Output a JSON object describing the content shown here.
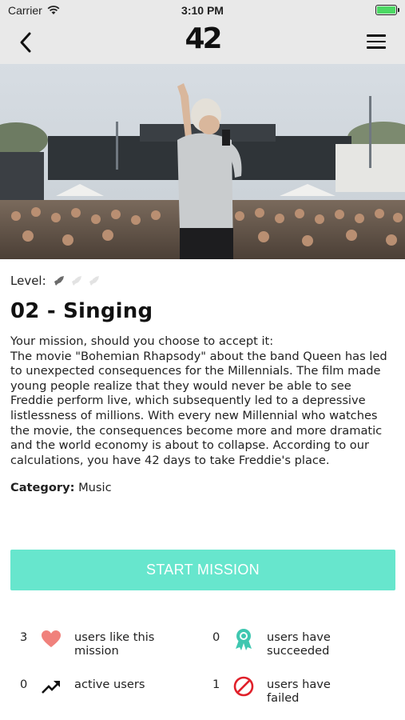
{
  "status_bar": {
    "carrier": "Carrier",
    "time": "3:10 PM",
    "battery_level": 1.0
  },
  "nav": {
    "logo": "42",
    "back_icon": "chevron-left-icon",
    "menu_icon": "hamburger-menu-icon"
  },
  "hero": {
    "icon": "concert-photo"
  },
  "mission": {
    "level_label": "Level:",
    "level_value": 1,
    "level_max": 3,
    "title": "02 - Singing",
    "description": "Your mission, should you choose to accept it:\nThe movie \"Bohemian Rhapsody\" about the band Queen has led to unexpected consequences for the Millennials. The film made young people realize that they would never be able to see Freddie perform live, which subsequently led to a depressive listlessness of millions. With every new Millennial who watches the movie, the consequences become more and more dramatic and the world economy is about to collapse. According to our calculations, you have 42 days to take Freddie's place.",
    "category_label": "Category:",
    "category_value": "Music"
  },
  "start_button": {
    "label": "START MISSION",
    "color": "#67e6cd"
  },
  "stats": {
    "likes": {
      "count": "3",
      "label": "users like this mission",
      "icon": "heart-icon",
      "color": "#f0817c"
    },
    "succeeded": {
      "count": "0",
      "label": "users have succeeded",
      "icon": "award-ribbon-icon",
      "color": "#3fc7b0"
    },
    "active": {
      "count": "0",
      "label": "active users",
      "icon": "trending-up-icon",
      "color": "#111111"
    },
    "failed": {
      "count": "1",
      "label": "users have failed",
      "icon": "prohibited-icon",
      "color": "#e0202a"
    }
  }
}
